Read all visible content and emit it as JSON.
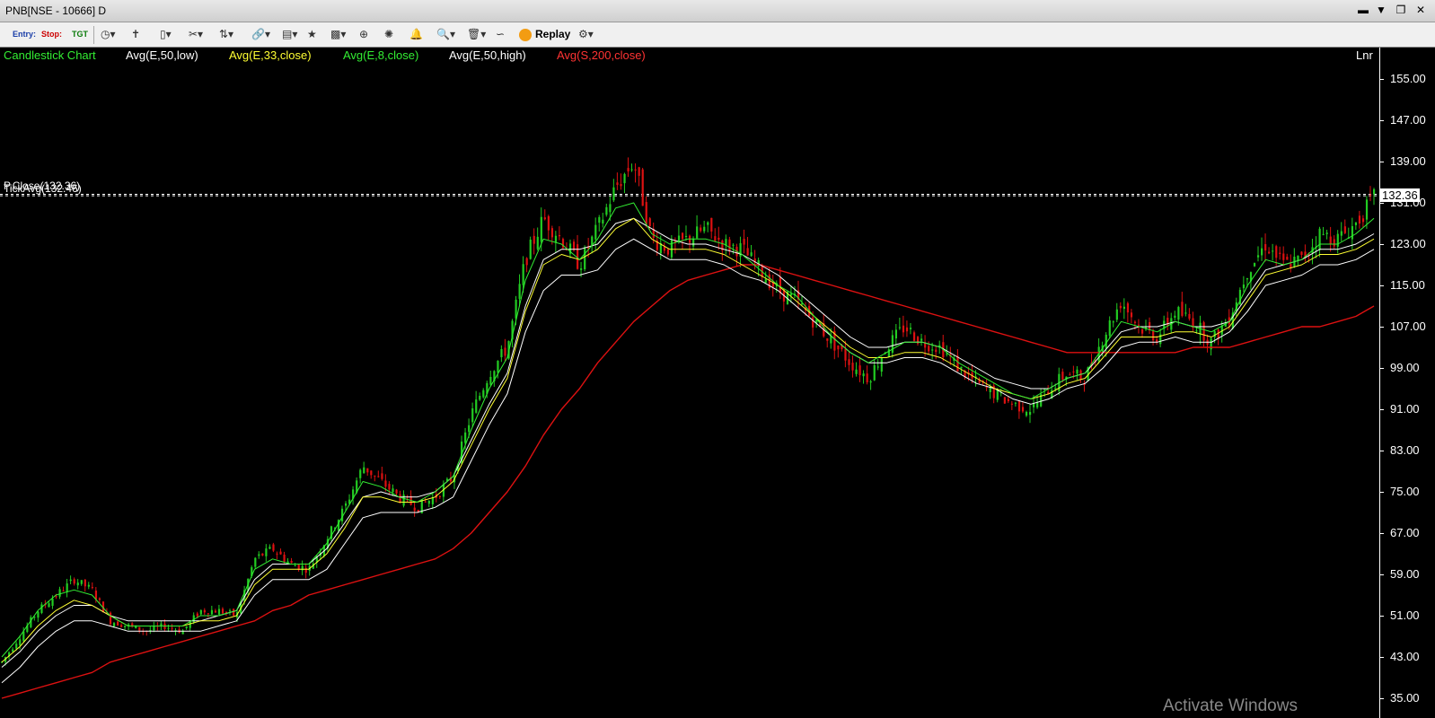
{
  "window": {
    "title": "PNB[NSE - 10666] D"
  },
  "toolbar": {
    "entry_label": "Entry:",
    "stop_label": "Stop:",
    "tgt_label": "TGT",
    "replay_label": "Replay"
  },
  "legend": {
    "chart_type": "Candlestick Chart",
    "ma1": "Avg(E,50,low)",
    "ma2": "Avg(E,33,close)",
    "ma3": "Avg(E,8,close)",
    "ma4": "Avg(E,50,high)",
    "ma5": "Avg(S,200,close)"
  },
  "axis": {
    "scale_label": "Lnr",
    "y_ticks": [
      "155.00",
      "147.00",
      "139.00",
      "131.00",
      "123.00",
      "115.00",
      "107.00",
      "99.00",
      "91.00",
      "83.00",
      "75.00",
      "67.00",
      "59.00",
      "51.00",
      "43.00",
      "35.00"
    ]
  },
  "overlays": {
    "p_close_label": "P.Close(132.36)",
    "tick_avg_label": "TickAvg(132.46)",
    "last_price": "132.36"
  },
  "watermark": "Activate Windows",
  "colors": {
    "background": "#000000",
    "up": "#22cc22",
    "down": "#dd1111",
    "ema50_low": "#ffffff",
    "ema33_close": "#ffff33",
    "ema8_close": "#33ee33",
    "ema50_high": "#ffffff",
    "sma200": "#dd1111"
  },
  "chart_data": {
    "type": "candlestick",
    "symbol": "PNB",
    "exchange": "NSE",
    "interval": "D",
    "ylim": [
      33,
      159
    ],
    "close_path": [
      42,
      47,
      52,
      55,
      58,
      56,
      50,
      49,
      48,
      49,
      48,
      52,
      52,
      51,
      62,
      64,
      61,
      60,
      66,
      72,
      80,
      77,
      74,
      72,
      74,
      78,
      90,
      98,
      103,
      120,
      128,
      124,
      119,
      126,
      134,
      139,
      124,
      122,
      124,
      126,
      123,
      122,
      118,
      114,
      112,
      108,
      104,
      100,
      97,
      103,
      107,
      104,
      103,
      99,
      96,
      94,
      92,
      91,
      95,
      98,
      97,
      105,
      112,
      107,
      105,
      110,
      108,
      104,
      109,
      118,
      123,
      119,
      120,
      125,
      124,
      127,
      132
    ],
    "ma_ema8_close": [
      43,
      47,
      52,
      55,
      56,
      55,
      51,
      49,
      49,
      49,
      49,
      51,
      51,
      52,
      60,
      62,
      61,
      61,
      65,
      71,
      77,
      76,
      74,
      73,
      75,
      78,
      87,
      95,
      101,
      116,
      124,
      123,
      120,
      124,
      130,
      131,
      125,
      123,
      124,
      124,
      123,
      121,
      118,
      115,
      113,
      109,
      105,
      102,
      100,
      102,
      104,
      104,
      103,
      100,
      98,
      96,
      94,
      93,
      95,
      97,
      98,
      103,
      108,
      107,
      106,
      108,
      107,
      106,
      108,
      115,
      120,
      119,
      120,
      123,
      123,
      125,
      128
    ],
    "ma_ema33_close": [
      42,
      45,
      49,
      52,
      54,
      53,
      51,
      49,
      49,
      49,
      49,
      50,
      50,
      51,
      57,
      60,
      60,
      60,
      63,
      68,
      74,
      74,
      73,
      73,
      74,
      77,
      84,
      91,
      97,
      110,
      119,
      121,
      120,
      122,
      126,
      128,
      124,
      122,
      122,
      122,
      121,
      119,
      117,
      115,
      112,
      109,
      106,
      103,
      101,
      101,
      102,
      102,
      101,
      99,
      97,
      95,
      94,
      93,
      94,
      96,
      97,
      101,
      105,
      105,
      105,
      106,
      106,
      105,
      107,
      112,
      117,
      118,
      119,
      121,
      121,
      122,
      124
    ],
    "ma_ema50_high": [
      41,
      44,
      48,
      51,
      53,
      53,
      51,
      50,
      50,
      50,
      50,
      50,
      51,
      52,
      58,
      61,
      61,
      61,
      64,
      69,
      74,
      75,
      74,
      74,
      75,
      78,
      85,
      92,
      98,
      111,
      120,
      122,
      122,
      123,
      127,
      128,
      126,
      124,
      123,
      123,
      122,
      121,
      119,
      117,
      114,
      111,
      108,
      105,
      103,
      103,
      104,
      104,
      103,
      101,
      99,
      97,
      96,
      95,
      95,
      97,
      98,
      102,
      106,
      107,
      107,
      108,
      107,
      107,
      108,
      113,
      118,
      119,
      120,
      122,
      122,
      123,
      125
    ],
    "ma_ema50_low": [
      38,
      41,
      45,
      48,
      50,
      50,
      49,
      48,
      48,
      48,
      48,
      48,
      49,
      50,
      55,
      58,
      58,
      58,
      60,
      65,
      70,
      71,
      71,
      71,
      72,
      74,
      81,
      88,
      94,
      106,
      114,
      117,
      117,
      118,
      122,
      124,
      122,
      120,
      120,
      120,
      119,
      117,
      116,
      114,
      111,
      108,
      105,
      102,
      100,
      100,
      101,
      101,
      100,
      98,
      96,
      95,
      93,
      92,
      93,
      95,
      96,
      99,
      103,
      104,
      104,
      105,
      104,
      104,
      106,
      110,
      115,
      116,
      117,
      119,
      119,
      120,
      122
    ],
    "ma_sma200_close": [
      35,
      36,
      37,
      38,
      39,
      40,
      42,
      43,
      44,
      45,
      46,
      47,
      48,
      49,
      50,
      52,
      53,
      55,
      56,
      57,
      58,
      59,
      60,
      61,
      62,
      64,
      67,
      71,
      75,
      80,
      86,
      91,
      95,
      100,
      104,
      108,
      111,
      114,
      116,
      117,
      118,
      119,
      119,
      118,
      117,
      116,
      115,
      114,
      113,
      112,
      111,
      110,
      109,
      108,
      107,
      106,
      105,
      104,
      103,
      102,
      102,
      102,
      102,
      102,
      102,
      102,
      103,
      103,
      103,
      104,
      105,
      106,
      107,
      107,
      108,
      109,
      111
    ]
  }
}
